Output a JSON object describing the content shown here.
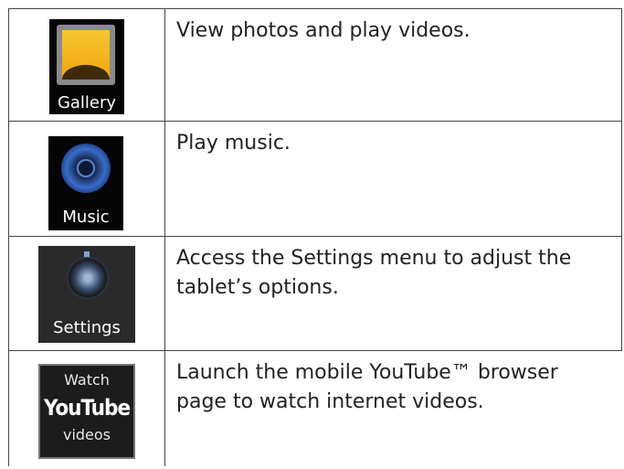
{
  "rows": [
    {
      "tile_label": "Gallery",
      "icon": "gallery-icon",
      "description": "View photos and play videos."
    },
    {
      "tile_label": "Music",
      "icon": "music-icon",
      "description": "Play music."
    },
    {
      "tile_label": "Settings",
      "icon": "settings-icon",
      "description": "Access the Settings menu to adjust the tablet’s options."
    },
    {
      "tile_label_top": "Watch",
      "tile_label_brand": "YouTube",
      "tile_label_bottom": "videos",
      "icon": "youtube-icon",
      "description": "Launch the mobile YouTube™ browser page to watch internet videos."
    }
  ]
}
